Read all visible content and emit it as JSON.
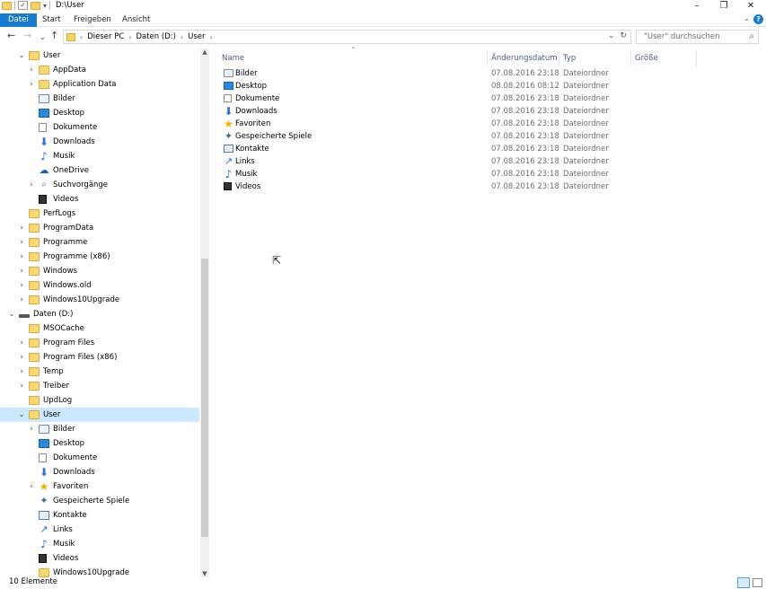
{
  "window": {
    "title": "D:\\User",
    "minimize": "–",
    "maximize": "❐",
    "close": "✕"
  },
  "ribbon": {
    "tabs": [
      "Datei",
      "Start",
      "Freigeben",
      "Ansicht"
    ],
    "help": "?",
    "collapse": "⌄"
  },
  "nav": {
    "back": "←",
    "forward": "→",
    "recent": "⌄",
    "up": "↑",
    "crumbs": [
      "Dieser PC",
      "Daten (D:)",
      "User"
    ],
    "refresh": "↻",
    "dropdown": "⌄",
    "search_placeholder": "\"User\" durchsuchen",
    "search_icon": "⌕"
  },
  "tree": [
    {
      "label": "User",
      "chev": "⌄",
      "icon": "folder"
    },
    {
      "label": "AppData",
      "chev": "›",
      "icon": "folder"
    },
    {
      "label": "Application Data",
      "chev": "›",
      "icon": "folder"
    },
    {
      "label": "Bilder",
      "chev": "",
      "icon": "pictures"
    },
    {
      "label": "Desktop",
      "chev": "",
      "icon": "desktop"
    },
    {
      "label": "Dokumente",
      "chev": "",
      "icon": "documents"
    },
    {
      "label": "Downloads",
      "chev": "",
      "icon": "downloads"
    },
    {
      "label": "Musik",
      "chev": "",
      "icon": "music"
    },
    {
      "label": "OneDrive",
      "chev": "",
      "icon": "onedrive"
    },
    {
      "label": "Suchvorgänge",
      "chev": "›",
      "icon": "searches"
    },
    {
      "label": "Videos",
      "chev": "",
      "icon": "videos"
    },
    {
      "label": "PerfLogs",
      "chev": "",
      "icon": "folder"
    },
    {
      "label": "ProgramData",
      "chev": "›",
      "icon": "folder"
    },
    {
      "label": "Programme",
      "chev": "›",
      "icon": "folder"
    },
    {
      "label": "Programme (x86)",
      "chev": "›",
      "icon": "folder"
    },
    {
      "label": "Windows",
      "chev": "›",
      "icon": "folder"
    },
    {
      "label": "Windows.old",
      "chev": "›",
      "icon": "folder"
    },
    {
      "label": "Windows10Upgrade",
      "chev": "›",
      "icon": "folder"
    },
    {
      "label": "Daten (D:)",
      "chev": "⌄",
      "icon": "drive"
    },
    {
      "label": "MSOCache",
      "chev": "",
      "icon": "folder"
    },
    {
      "label": "Program Files",
      "chev": "›",
      "icon": "folder"
    },
    {
      "label": "Program Files (x86)",
      "chev": "›",
      "icon": "folder"
    },
    {
      "label": "Temp",
      "chev": "›",
      "icon": "folder"
    },
    {
      "label": "Treiber",
      "chev": "›",
      "icon": "folder"
    },
    {
      "label": "UpdLog",
      "chev": "",
      "icon": "folder"
    },
    {
      "label": "User",
      "chev": "⌄",
      "icon": "folder",
      "selected": true
    },
    {
      "label": "Bilder",
      "chev": "›",
      "icon": "pictures"
    },
    {
      "label": "Desktop",
      "chev": "",
      "icon": "desktop"
    },
    {
      "label": "Dokumente",
      "chev": "",
      "icon": "documents"
    },
    {
      "label": "Downloads",
      "chev": "",
      "icon": "downloads"
    },
    {
      "label": "Favoriten",
      "chev": "›",
      "icon": "favorites"
    },
    {
      "label": "Gespeicherte Spiele",
      "chev": "",
      "icon": "games"
    },
    {
      "label": "Kontakte",
      "chev": "",
      "icon": "contacts"
    },
    {
      "label": "Links",
      "chev": "",
      "icon": "links"
    },
    {
      "label": "Musik",
      "chev": "",
      "icon": "music"
    },
    {
      "label": "Videos",
      "chev": "",
      "icon": "videos"
    },
    {
      "label": "Windows10Upgrade",
      "chev": "",
      "icon": "folder"
    }
  ],
  "columns": {
    "name": "Name",
    "date": "Änderungsdatum",
    "type": "Typ",
    "size": "Größe",
    "sort_indicator": "⌃"
  },
  "files": [
    {
      "name": "Bilder",
      "date": "07.08.2016 23:18",
      "type": "Dateiordner",
      "icon": "pictures"
    },
    {
      "name": "Desktop",
      "date": "08.08.2016 08:12",
      "type": "Dateiordner",
      "icon": "desktop"
    },
    {
      "name": "Dokumente",
      "date": "07.08.2016 23:18",
      "type": "Dateiordner",
      "icon": "documents"
    },
    {
      "name": "Downloads",
      "date": "07.08.2016 23:18",
      "type": "Dateiordner",
      "icon": "downloads"
    },
    {
      "name": "Favoriten",
      "date": "07.08.2016 23:18",
      "type": "Dateiordner",
      "icon": "favorites"
    },
    {
      "name": "Gespeicherte Spiele",
      "date": "07.08.2016 23:18",
      "type": "Dateiordner",
      "icon": "games"
    },
    {
      "name": "Kontakte",
      "date": "07.08.2016 23:18",
      "type": "Dateiordner",
      "icon": "contacts"
    },
    {
      "name": "Links",
      "date": "07.08.2016 23:18",
      "type": "Dateiordner",
      "icon": "links"
    },
    {
      "name": "Musik",
      "date": "07.08.2016 23:18",
      "type": "Dateiordner",
      "icon": "music"
    },
    {
      "name": "Videos",
      "date": "07.08.2016 23:18",
      "type": "Dateiordner",
      "icon": "videos"
    }
  ],
  "status": {
    "count": "10 Elemente"
  },
  "colors": {
    "accent": "#1979ca",
    "selection": "#cce8ff",
    "folder": "#f8d775"
  }
}
